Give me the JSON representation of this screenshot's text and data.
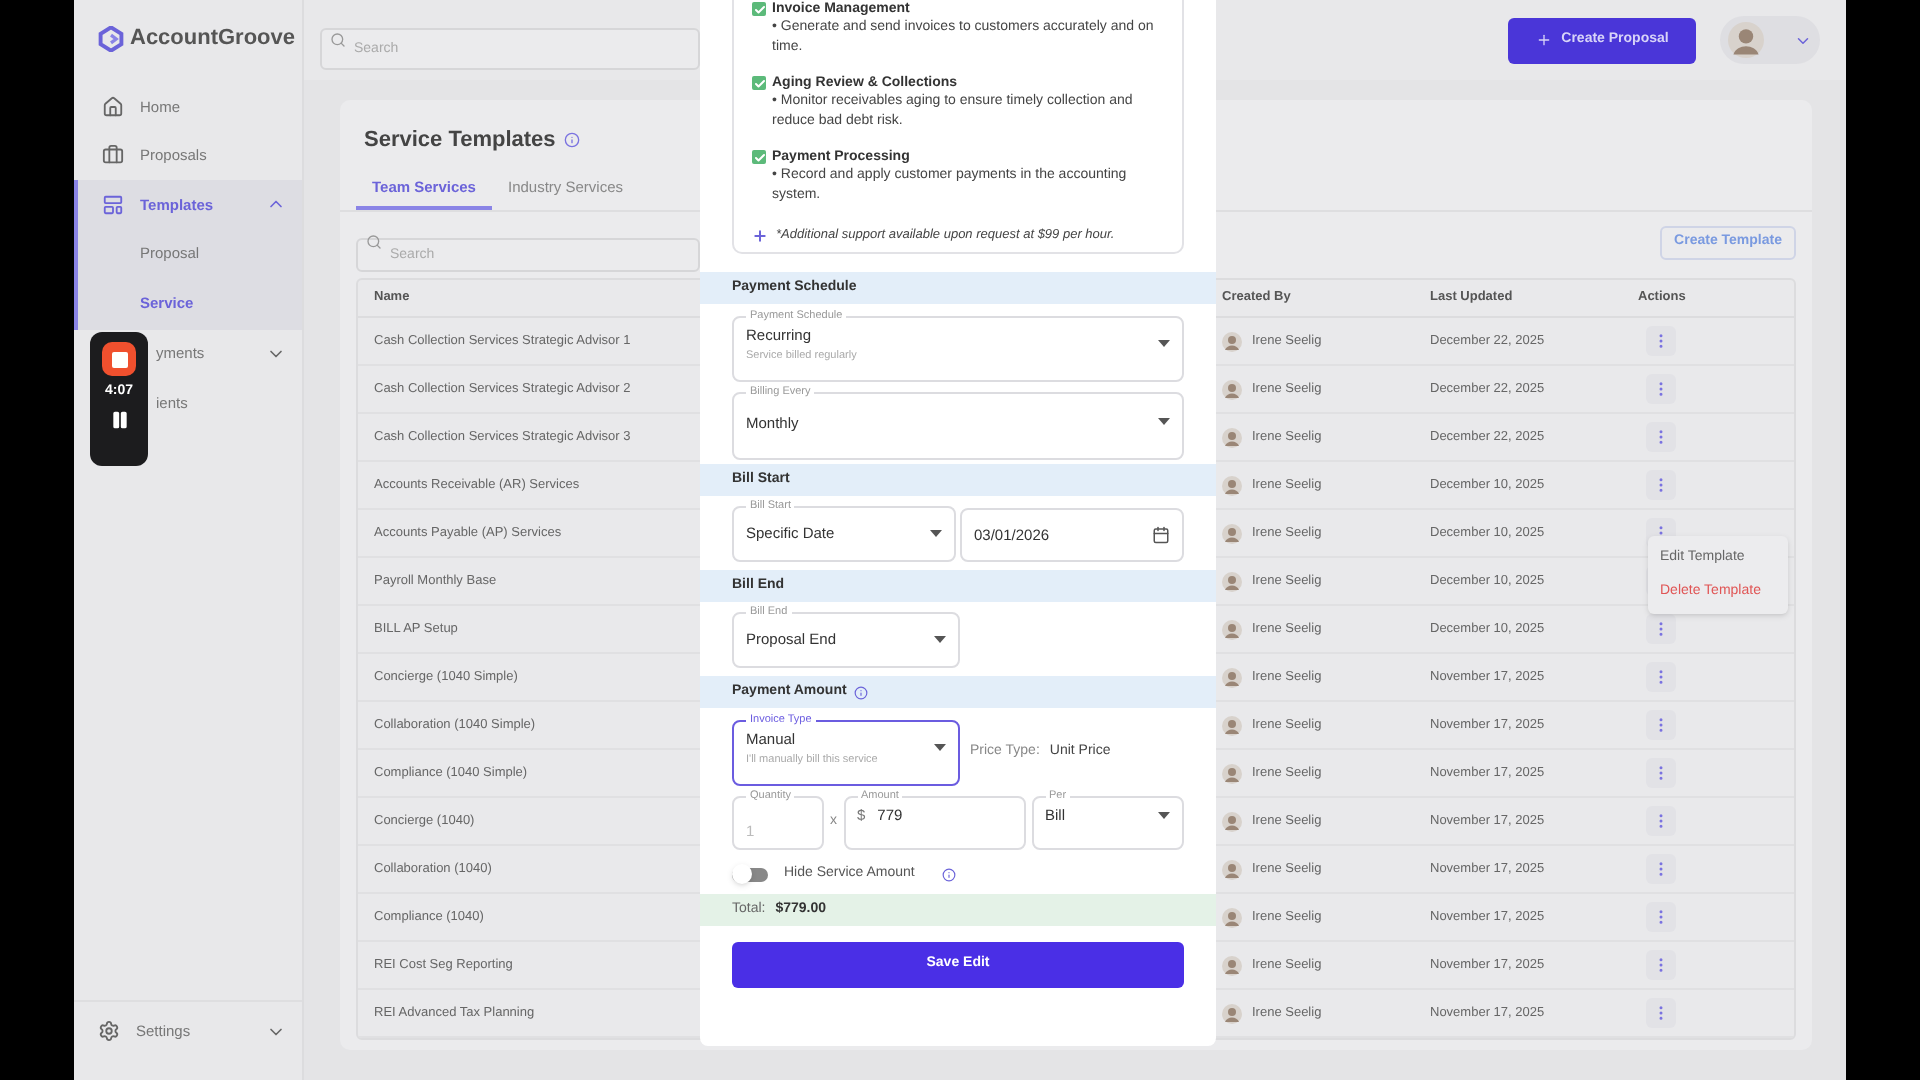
{
  "sidebar": {
    "logo": "AccountGroove",
    "items": [
      {
        "label": "Home",
        "kind": "home",
        "selected": false
      },
      {
        "label": "Proposals",
        "kind": "briefcase",
        "selected": false
      },
      {
        "label": "Templates",
        "kind": "templates",
        "selected": true,
        "expanded": true,
        "children": [
          {
            "label": "Proposal",
            "selected": false
          },
          {
            "label": "Service",
            "selected": true
          }
        ]
      },
      {
        "label": "yments",
        "kind": "covered",
        "selected": false,
        "expanded": false
      },
      {
        "label": "ients",
        "kind": "covered",
        "selected": false
      }
    ],
    "footer": {
      "label": "Settings",
      "expanded": false
    }
  },
  "topbar": {
    "search": {
      "placeholder": "Search"
    },
    "create_button": "Create Proposal"
  },
  "recorder": {
    "time": "4:07"
  },
  "page": {
    "title": "Service Templates",
    "tabs": [
      {
        "label": "Team Services",
        "selected": true
      },
      {
        "label": "Industry Services",
        "selected": false
      }
    ],
    "search": {
      "placeholder": "Search"
    },
    "create_button": "Create Template",
    "table": {
      "columns": [
        "Name",
        "Created By",
        "Last Updated",
        "Actions"
      ],
      "rows": [
        {
          "name": "Cash Collection Services Strategic Advisor 1",
          "created_by": "Irene Seelig",
          "last_updated": "December 22, 2025"
        },
        {
          "name": "Cash Collection Services Strategic Advisor 2",
          "created_by": "Irene Seelig",
          "last_updated": "December 22, 2025"
        },
        {
          "name": "Cash Collection Services Strategic Advisor 3",
          "created_by": "Irene Seelig",
          "last_updated": "December 22, 2025"
        },
        {
          "name": "Accounts Receivable (AR) Services",
          "created_by": "Irene Seelig",
          "last_updated": "December 10, 2025"
        },
        {
          "name": "Accounts Payable (AP) Services",
          "created_by": "Irene Seelig",
          "last_updated": "December 10, 2025"
        },
        {
          "name": "Payroll Monthly Base",
          "created_by": "Irene Seelig",
          "last_updated": "December 10, 2025"
        },
        {
          "name": "BILL AP Setup",
          "created_by": "Irene Seelig",
          "last_updated": "December 10, 2025"
        },
        {
          "name": "Concierge (1040 Simple)",
          "created_by": "Irene Seelig",
          "last_updated": "November 17, 2025"
        },
        {
          "name": "Collaboration (1040 Simple)",
          "created_by": "Irene Seelig",
          "last_updated": "November 17, 2025"
        },
        {
          "name": "Compliance (1040 Simple)",
          "created_by": "Irene Seelig",
          "last_updated": "November 17, 2025"
        },
        {
          "name": "Concierge (1040)",
          "created_by": "Irene Seelig",
          "last_updated": "November 17, 2025"
        },
        {
          "name": "Collaboration (1040)",
          "created_by": "Irene Seelig",
          "last_updated": "November 17, 2025"
        },
        {
          "name": "Compliance (1040)",
          "created_by": "Irene Seelig",
          "last_updated": "November 17, 2025"
        },
        {
          "name": "REI Cost Seg Reporting",
          "created_by": "Irene Seelig",
          "last_updated": "November 17, 2025"
        },
        {
          "name": "REI Advanced Tax Planning",
          "created_by": "Irene Seelig",
          "last_updated": "November 17, 2025"
        }
      ]
    },
    "menu": {
      "items": [
        {
          "label": "Edit Template",
          "kind": "normal"
        },
        {
          "label": "Delete Template",
          "kind": "danger"
        }
      ]
    }
  },
  "modal": {
    "services": [
      {
        "title": "Invoice Management",
        "checked": true,
        "description": "• Generate and send invoices to customers accurately and on time."
      },
      {
        "title": "Aging Review & Collections",
        "checked": true,
        "description": "• Monitor receivables aging to ensure timely collection and reduce bad debt risk."
      },
      {
        "title": "Payment Processing",
        "checked": true,
        "description": "• Record and apply customer payments in the accounting system."
      }
    ],
    "note": "*Additional support available upon request at $99 per hour.",
    "payment_schedule": {
      "heading": "Payment Schedule",
      "schedule": {
        "label": "Payment Schedule",
        "value": "Recurring",
        "hint": "Service billed regularly"
      },
      "billing_every": {
        "label": "Billing Every",
        "value": "Monthly"
      }
    },
    "bill_start": {
      "heading": "Bill Start",
      "type": {
        "label": "Bill Start",
        "value": "Specific Date"
      },
      "date": "03/01/2026"
    },
    "bill_end": {
      "heading": "Bill End",
      "type": {
        "label": "Bill End",
        "value": "Proposal End"
      }
    },
    "payment_amount": {
      "heading": "Payment Amount",
      "invoice_type": {
        "label": "Invoice Type",
        "value": "Manual",
        "hint": "I'll manually bill this service",
        "focused": true
      },
      "price_type_label": "Price Type:",
      "price_type": "Unit Price",
      "quantity": {
        "label": "Quantity",
        "value": "1",
        "disabled": true
      },
      "times": "x",
      "amount": {
        "label": "Amount",
        "currency": "$",
        "value": "779"
      },
      "per": {
        "label": "Per",
        "value": "Bill"
      },
      "hide_amount": {
        "label": "Hide Service Amount",
        "on": false
      }
    },
    "total": {
      "label": "Total:",
      "value": "$779.00"
    },
    "save_button": "Save Edit"
  }
}
